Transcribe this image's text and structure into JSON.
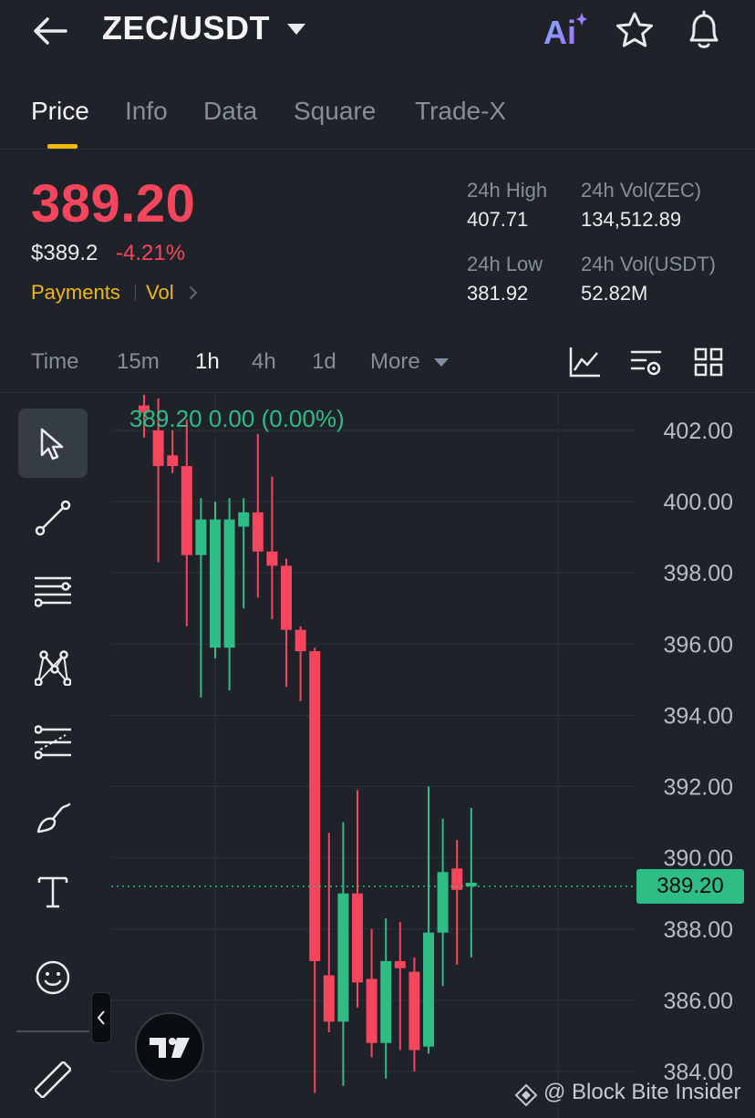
{
  "header": {
    "pair": "ZEC/USDT",
    "ai_label": "Ai"
  },
  "tabs": [
    {
      "label": "Price",
      "active": true
    },
    {
      "label": "Info"
    },
    {
      "label": "Data"
    },
    {
      "label": "Square"
    },
    {
      "label": "Trade-X"
    }
  ],
  "ticker": {
    "last_price": "389.20",
    "usd_price": "$389.2",
    "change_pct": "-4.21%",
    "tag_payments": "Payments",
    "tag_vol": "Vol",
    "stats": {
      "high_label": "24h High",
      "high_value": "407.71",
      "vol_base_label": "24h Vol(ZEC)",
      "vol_base_value": "134,512.89",
      "low_label": "24h Low",
      "low_value": "381.92",
      "vol_quote_label": "24h Vol(USDT)",
      "vol_quote_value": "52.82M"
    }
  },
  "intervals": [
    {
      "label": "Time"
    },
    {
      "label": "15m"
    },
    {
      "label": "1h",
      "active": true
    },
    {
      "label": "4h"
    },
    {
      "label": "1d"
    },
    {
      "label": "More"
    }
  ],
  "chart_overlay": {
    "ohlc_text": "389.20  0.00 (0.00%)",
    "current_price_badge": "389.20",
    "watermark": "@ Block Bite Insider",
    "tv_logo": "TV"
  },
  "colors": {
    "up": "#2ebd85",
    "down": "#f6465d",
    "accent": "#f0b90b",
    "background": "#1f2329"
  },
  "chart_data": {
    "type": "candlestick",
    "y_axis_ticks": [
      "402.00",
      "400.00",
      "398.00",
      "396.00",
      "394.00",
      "392.00",
      "390.00",
      "388.00",
      "386.00",
      "384.00"
    ],
    "ylim": [
      383.3,
      402.8
    ],
    "current_price": 389.2,
    "candles": [
      {
        "o": 402.7,
        "h": 403.0,
        "l": 401.8,
        "c": 402.5
      },
      {
        "o": 402.0,
        "h": 402.9,
        "l": 398.3,
        "c": 401.0
      },
      {
        "o": 401.3,
        "h": 402.0,
        "l": 400.8,
        "c": 401.0
      },
      {
        "o": 401.0,
        "h": 402.3,
        "l": 396.5,
        "c": 398.5
      },
      {
        "o": 398.5,
        "h": 400.1,
        "l": 394.5,
        "c": 399.5
      },
      {
        "o": 395.9,
        "h": 400.0,
        "l": 395.6,
        "c": 399.5
      },
      {
        "o": 395.9,
        "h": 400.1,
        "l": 394.7,
        "c": 399.5
      },
      {
        "o": 399.3,
        "h": 400.1,
        "l": 397.0,
        "c": 399.7
      },
      {
        "o": 399.7,
        "h": 401.9,
        "l": 397.3,
        "c": 398.6
      },
      {
        "o": 398.6,
        "h": 400.7,
        "l": 396.7,
        "c": 398.2
      },
      {
        "o": 398.2,
        "h": 398.4,
        "l": 394.8,
        "c": 396.4
      },
      {
        "o": 396.4,
        "h": 396.5,
        "l": 394.4,
        "c": 395.8
      },
      {
        "o": 395.8,
        "h": 395.9,
        "l": 383.4,
        "c": 387.1
      },
      {
        "o": 386.7,
        "h": 390.7,
        "l": 385.1,
        "c": 385.4
      },
      {
        "o": 385.4,
        "h": 391.0,
        "l": 383.6,
        "c": 389.0
      },
      {
        "o": 389.0,
        "h": 391.9,
        "l": 385.8,
        "c": 386.5
      },
      {
        "o": 386.6,
        "h": 388.0,
        "l": 384.4,
        "c": 384.8
      },
      {
        "o": 384.8,
        "h": 388.3,
        "l": 383.8,
        "c": 387.1
      },
      {
        "o": 387.1,
        "h": 388.2,
        "l": 384.6,
        "c": 386.9
      },
      {
        "o": 386.8,
        "h": 387.2,
        "l": 384.0,
        "c": 384.6
      },
      {
        "o": 384.7,
        "h": 392.0,
        "l": 384.5,
        "c": 387.9
      },
      {
        "o": 387.9,
        "h": 391.1,
        "l": 386.4,
        "c": 389.6
      },
      {
        "o": 389.7,
        "h": 390.5,
        "l": 387.0,
        "c": 389.1
      },
      {
        "o": 389.2,
        "h": 391.4,
        "l": 387.2,
        "c": 389.3
      }
    ]
  }
}
